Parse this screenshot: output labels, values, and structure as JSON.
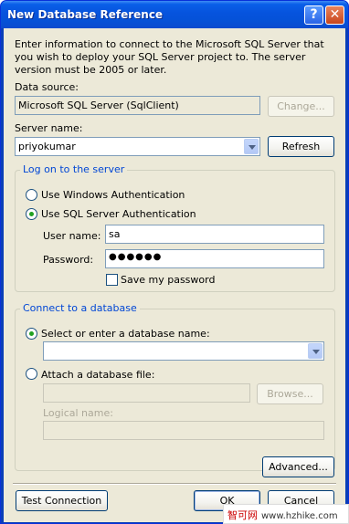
{
  "window": {
    "title": "New Database Reference",
    "help_glyph": "?",
    "close_glyph": "✕"
  },
  "intro_text": "Enter information to connect to the Microsoft SQL Server that you wish to deploy your SQL Server project to.  The server version must be 2005 or later.",
  "data_source": {
    "label": "Data source:",
    "value": "Microsoft SQL Server (SqlClient)",
    "change_button": "Change..."
  },
  "server_name": {
    "label": "Server name:",
    "value": "priyokumar",
    "refresh_button": "Refresh"
  },
  "logon": {
    "legend": "Log on to the server",
    "windows_auth": "Use Windows Authentication",
    "sql_auth": "Use SQL Server Authentication",
    "selected": "sql_auth",
    "user_label": "User name:",
    "user_value": "sa",
    "password_label": "Password:",
    "password_value": "●●●●●●",
    "save_password": "Save my password",
    "save_password_checked": false
  },
  "connect": {
    "legend": "Connect to a database",
    "select_db": "Select or enter a database name:",
    "select_db_value": "",
    "attach_file": "Attach a database file:",
    "attach_value": "",
    "browse_button": "Browse...",
    "logical_label": "Logical name:",
    "logical_value": ""
  },
  "buttons": {
    "advanced": "Advanced...",
    "test": "Test Connection",
    "ok": "OK",
    "cancel": "Cancel"
  },
  "watermark": {
    "brand": "智可网",
    "site": "www.hzhike.com"
  }
}
